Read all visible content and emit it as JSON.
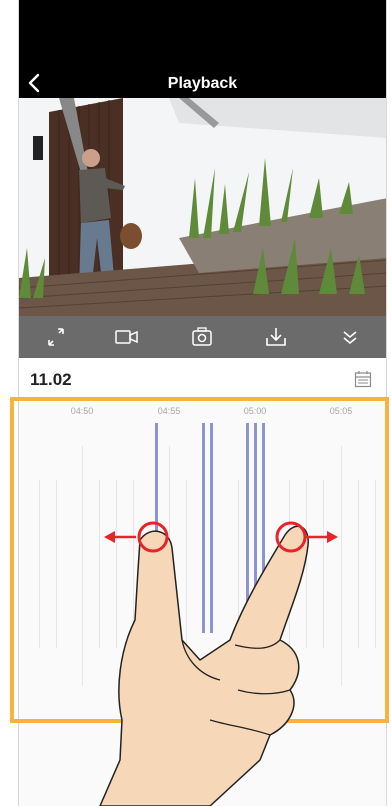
{
  "header": {
    "title": "Playback"
  },
  "controls": {
    "buttons": [
      "fullscreen-icon",
      "record-icon",
      "snapshot-icon",
      "download-icon",
      "expand-down-icon"
    ]
  },
  "timeline": {
    "date": "11.02",
    "tick_labels": [
      "04:50",
      "04:55",
      "05:00",
      "05:05"
    ]
  },
  "colors": {
    "accent": "#f7b33e",
    "recording": "#8d94cf",
    "arrow": "#e8232a"
  }
}
